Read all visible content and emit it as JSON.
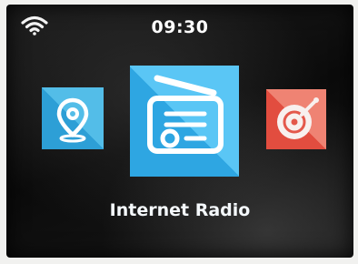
{
  "status_bar": {
    "wifi_icon": "wifi-icon",
    "time": "09:30"
  },
  "carousel": {
    "items": [
      {
        "icon": "map-pin-icon",
        "accent": "#2d9fd6"
      },
      {
        "icon": "radio-icon",
        "accent": "#2ea6e2",
        "selected": true
      },
      {
        "icon": "music-disc-icon",
        "accent": "#e24d3f"
      }
    ],
    "selected_label": "Internet Radio"
  }
}
